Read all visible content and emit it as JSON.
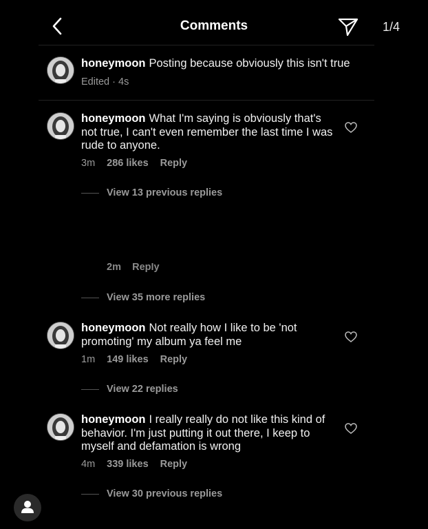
{
  "header": {
    "title": "Comments",
    "page_count": "1/4"
  },
  "caption": {
    "username": "honeymoon",
    "text": "Posting because obviously this isn't true",
    "meta": "Edited · 4s"
  },
  "comments": [
    {
      "username": "honeymoon",
      "text": "What I'm saying is obviously that's not true, I can't even remember the last time I was rude to anyone.",
      "time": "3m",
      "likes": "286 likes",
      "reply": "Reply",
      "replies": "View 13 previous replies"
    },
    {
      "username": "honeymoon",
      "text": "Not really how I like to be 'not promoting' my album ya feel me",
      "time": "1m",
      "likes": "149 likes",
      "reply": "Reply",
      "replies": "View 22 replies"
    },
    {
      "username": "honeymoon",
      "text": "I really really do not like this kind of behavior. I'm just putting it out there, I keep to myself and defamation is wrong",
      "time": "4m",
      "likes": "339 likes",
      "reply": "Reply",
      "replies": "View 30 previous replies"
    }
  ],
  "hidden_reply": {
    "time": "2m",
    "reply": "Reply",
    "more": "View 35 more replies"
  },
  "icons": {
    "back": "chevron-left-icon",
    "send": "paper-plane-icon",
    "heart": "heart-outline-icon",
    "profile": "person-icon"
  },
  "colors": {
    "background": "#000000",
    "text": "#f5f5f5",
    "muted": "#9a9a9a"
  }
}
